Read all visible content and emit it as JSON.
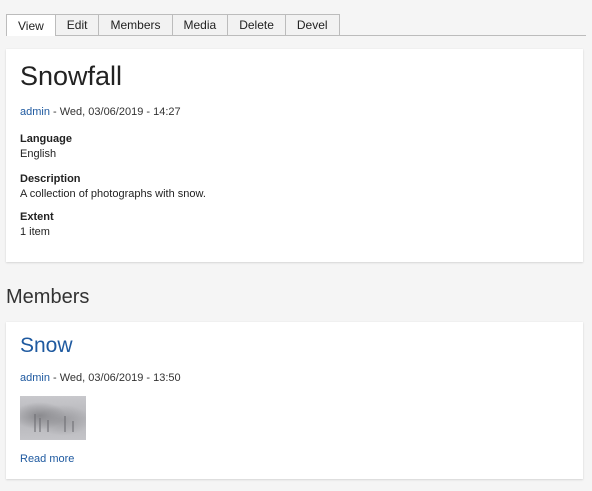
{
  "tabs": [
    {
      "label": "View",
      "active": true
    },
    {
      "label": "Edit",
      "active": false
    },
    {
      "label": "Members",
      "active": false
    },
    {
      "label": "Media",
      "active": false
    },
    {
      "label": "Delete",
      "active": false
    },
    {
      "label": "Devel",
      "active": false
    }
  ],
  "item": {
    "title": "Snowfall",
    "author": "admin",
    "date": " - Wed, 03/06/2019 - 14:27",
    "fields": {
      "language": {
        "label": "Language",
        "value": "English"
      },
      "description": {
        "label": "Description",
        "value": "A collection of photographs with snow."
      },
      "extent": {
        "label": "Extent",
        "value": "1 item"
      }
    }
  },
  "members": {
    "heading": "Members",
    "items": [
      {
        "title": "Snow",
        "author": "admin",
        "date": " - Wed, 03/06/2019 - 13:50",
        "read_more": "Read more"
      }
    ]
  },
  "colors": {
    "link": "#1f5aa0",
    "background": "#f5f5f5",
    "card": "#ffffff"
  }
}
